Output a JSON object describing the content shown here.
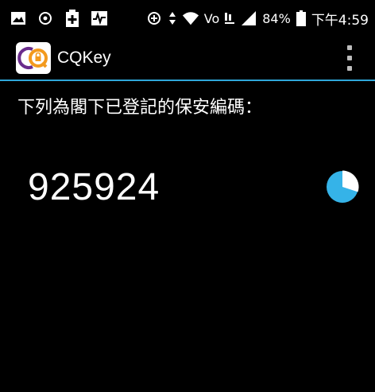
{
  "status_bar": {
    "battery_percent": "84%",
    "time": "下午4:59",
    "network_label": "Vo",
    "left_icons": [
      "image-icon",
      "settings-circle-icon",
      "medical-cross-icon",
      "activity-icon"
    ],
    "right_icons": [
      "sync-icon",
      "data-arrows-icon",
      "wifi-icon",
      "volte-icon",
      "signal-icon",
      "battery-icon"
    ]
  },
  "app_bar": {
    "title": "CQKey",
    "logo_text": "CQ"
  },
  "content": {
    "instruction": "下列為閣下已登記的保安編碼：",
    "security_code": "925924",
    "timer_remaining_fraction": 0.7
  },
  "colors": {
    "accent": "#2fa7d9",
    "background": "#000000",
    "logo_purple": "#6a2c8c",
    "logo_orange": "#f39a1e"
  }
}
